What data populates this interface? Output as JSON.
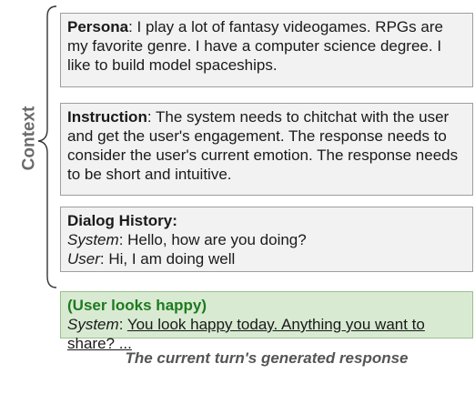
{
  "context_label": "Context",
  "persona": {
    "label": "Persona",
    "text": ": I play a lot of fantasy videogames. RPGs are my favorite genre. I have a computer science degree. I like to build model spaceships."
  },
  "instruction": {
    "label": "Instruction",
    "text": ": The system needs to chitchat with the user and get the user's engagement. The response needs to consider the user's current emotion. The response needs to be short and intuitive."
  },
  "dialog_history": {
    "label": "Dialog History:",
    "turns": [
      {
        "speaker": "System",
        "text": ": Hello, how are you doing?"
      },
      {
        "speaker": "User",
        "text": ": Hi, I am doing well"
      }
    ]
  },
  "response": {
    "emotion": "(User looks happy)",
    "speaker": "System",
    "separator": ": ",
    "text": "You look happy today. Anything you want to share? ..."
  },
  "caption": "The current turn's generated response",
  "colors": {
    "context_box_bg": "#f2f2f2",
    "response_box_bg": "#d9ead3",
    "emotion_text": "#1e7a1e",
    "context_label": "#6b6b6b"
  }
}
